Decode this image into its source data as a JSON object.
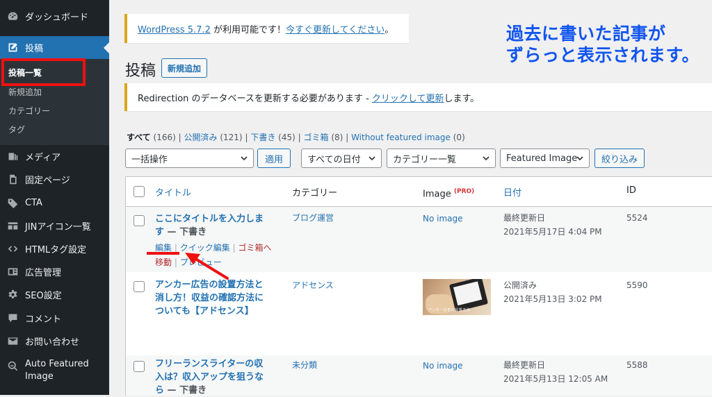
{
  "sidebar": {
    "dashboard": "ダッシュボード",
    "posts": "投稿",
    "submenu": [
      "投稿一覧",
      "新規追加",
      "カテゴリー",
      "タグ"
    ],
    "items": [
      "メディア",
      "固定ページ",
      "CTA",
      "JINアイコン一覧",
      "HTMLタグ設定",
      "広告管理",
      "SEO設定",
      "コメント",
      "お問い合わせ"
    ],
    "auto_featured_1": "Auto Featured",
    "auto_featured_2": "Image"
  },
  "notice_update": {
    "version_link": "WordPress 5.7.2",
    "text": " が利用可能です！",
    "update_link": "今すぐ更新してください",
    "end": "。"
  },
  "annotation": {
    "line1": "過去に書いた記事が",
    "line2": "ずらっと表示されます。"
  },
  "page": {
    "title": "投稿",
    "add_new": "新規追加"
  },
  "notice_redirection": {
    "text": "Redirection のデータベースを更新する必要があります - ",
    "link": "クリックして更新",
    "end": "します。"
  },
  "filters": {
    "all": "すべて",
    "all_count": "(166)",
    "published": "公開済み",
    "published_count": "(121)",
    "draft": "下書き",
    "draft_count": "(45)",
    "trash": "ゴミ箱",
    "trash_count": "(8)",
    "without_image": "Without featured image",
    "without_image_count": "(0)",
    "sep": "|"
  },
  "bulk": {
    "action": "一括操作",
    "apply": "適用",
    "dates": "すべての日付",
    "categories": "カテゴリー一覧",
    "featured": "Featured Image",
    "filter": "絞り込み"
  },
  "columns": {
    "title": "タイトル",
    "category": "カテゴリー",
    "image": "Image",
    "pro": "(PRO)",
    "date": "日付",
    "id": "ID"
  },
  "rows": [
    {
      "title_1": "ここにタイトルを入力しま",
      "title_2": "す",
      "state": " — 下書き",
      "category": "ブログ運営",
      "image": "No image",
      "status": "最終更新日",
      "date": "2021年5月17日 4:04 PM",
      "id": "5524",
      "edit": "編集",
      "quick_edit": "クイック編集",
      "trash_1": "ゴミ箱へ",
      "trash_2": "移動",
      "preview": "プレビュー"
    },
    {
      "title_1": "アンカー広告の設置方法と",
      "title_2": "消し方！収益の確認方法に",
      "title_3": "ついても【アドセンス】",
      "category": "アドセンス",
      "thumb_caption": "アンカー広告の設置方法",
      "status": "公開済み",
      "date": "2021年5月13日 3:02 PM",
      "id": "5590"
    },
    {
      "title_1": "フリーランスライターの収",
      "title_2": "入は？収入アップを狙うな",
      "title_3": "ら",
      "state": " — 下書き",
      "category": "未分類",
      "image": "No image",
      "status": "最終更新日",
      "date": "2021年5月13日 12:05 AM",
      "id": "5588"
    }
  ],
  "colors": {
    "sidebar": "#1d2327",
    "active": "#2271b1",
    "annotation": "#1155ee",
    "highlight": "#ee1111"
  }
}
